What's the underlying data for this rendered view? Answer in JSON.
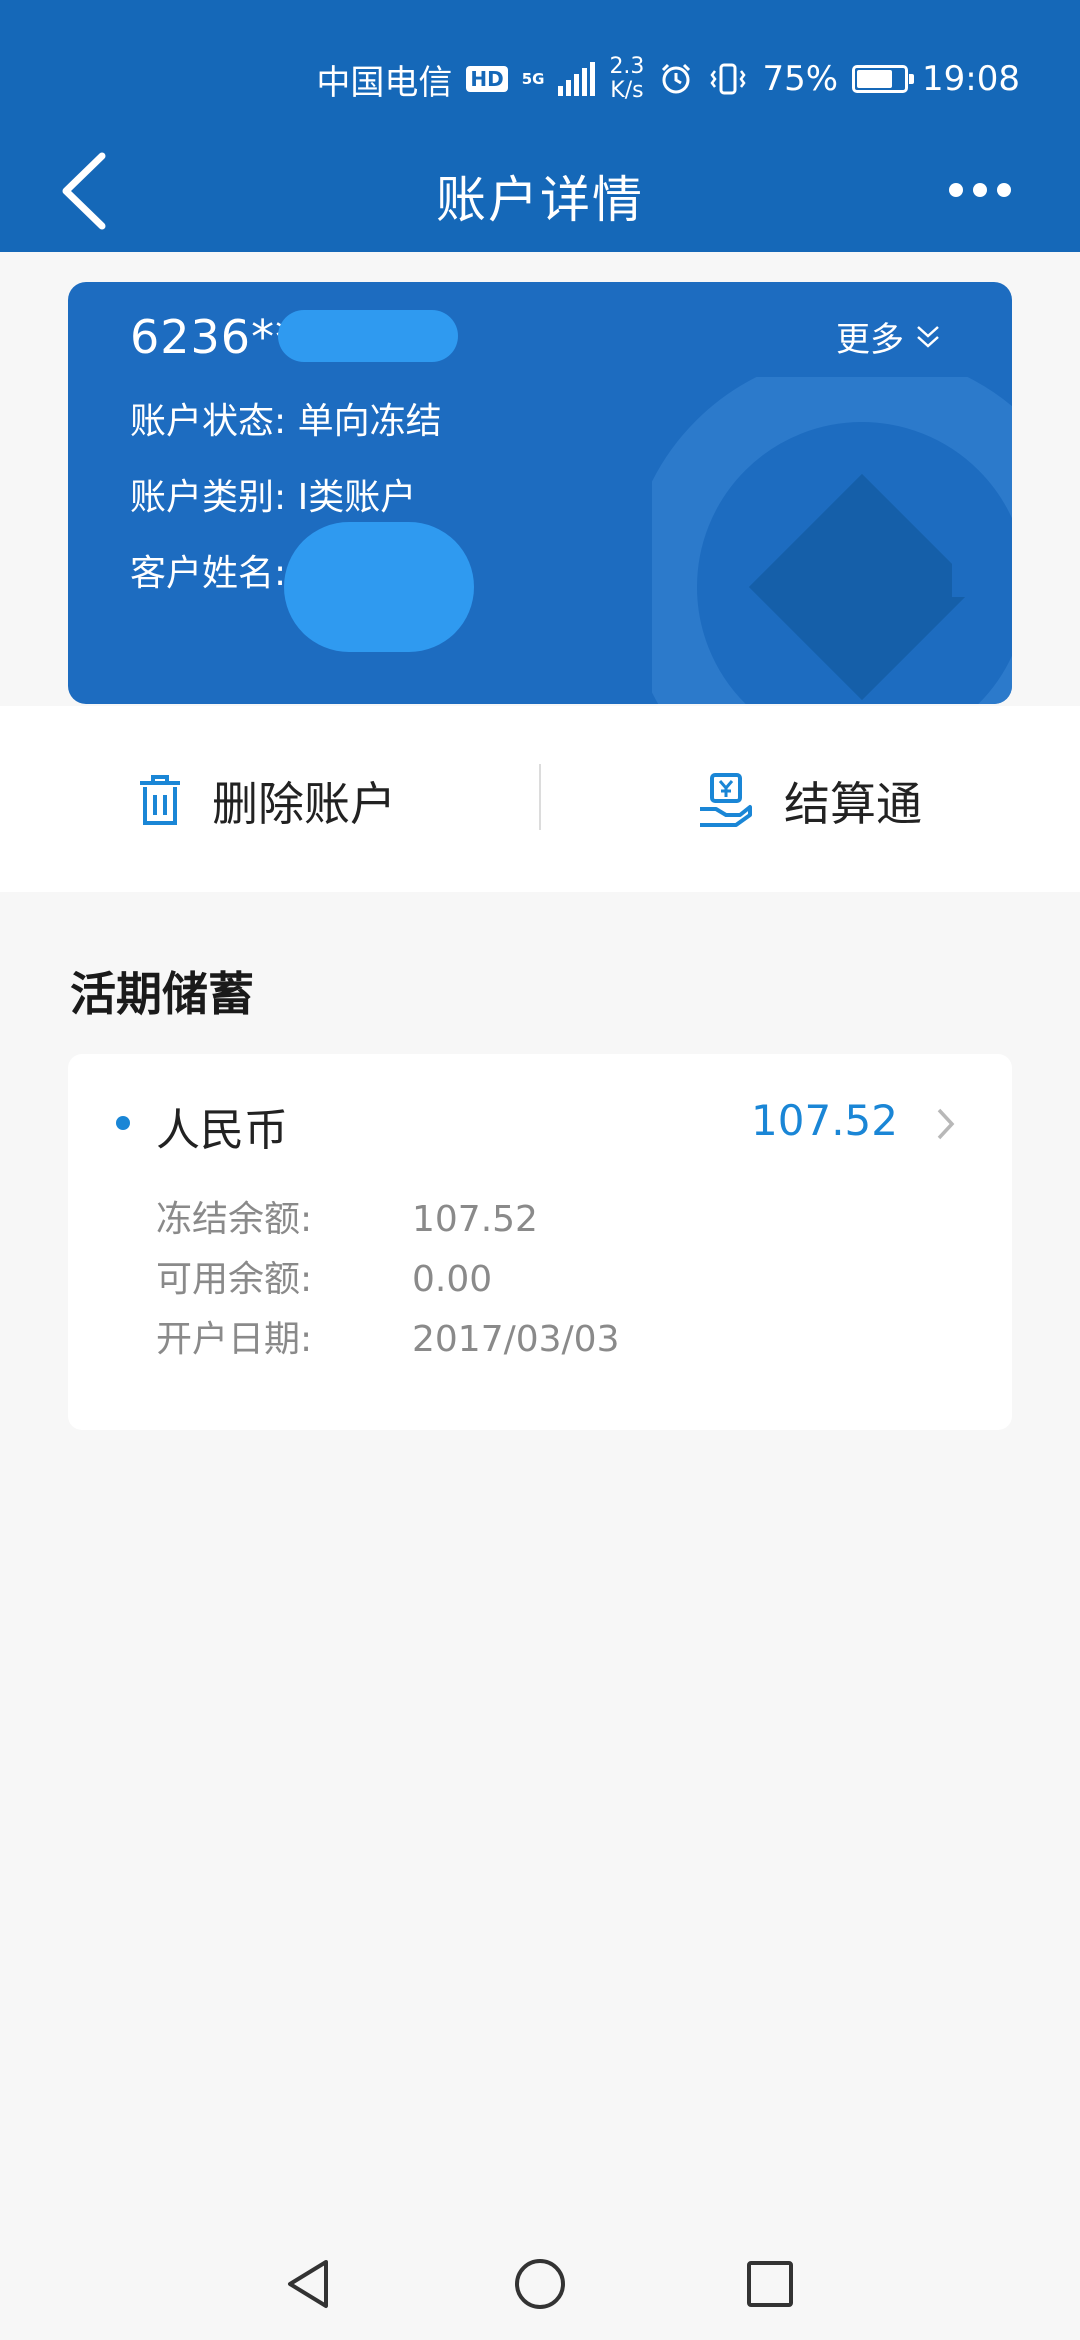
{
  "status_bar": {
    "carrier": "中国电信",
    "hd_badge": "HD",
    "network": "5G",
    "speed_value": "2.3",
    "speed_unit": "K/s",
    "battery_percent": "75%",
    "battery_level": 0.75,
    "time": "19:08"
  },
  "header": {
    "title": "账户详情"
  },
  "account_card": {
    "account_number": "6236***",
    "more_label": "更多",
    "status": "账户状态: 单向冻结",
    "type": "账户类别: Ⅰ类账户",
    "customer": "客户姓名:"
  },
  "actions": {
    "delete_label": "删除账户",
    "settlement_label": "结算通"
  },
  "section": {
    "title": "活期储蓄"
  },
  "deposit": {
    "currency": "人民币",
    "amount": "107.52",
    "rows": [
      {
        "label": "冻结余额:",
        "value": "107.52"
      },
      {
        "label": "可用余额:",
        "value": "0.00"
      },
      {
        "label": "开户日期:",
        "value": "2017/03/03"
      }
    ]
  },
  "colors": {
    "brand_blue": "#1568b8",
    "card_blue": "#1d6cc0",
    "accent_blue": "#1a86d6",
    "background": "#f7f7f7"
  }
}
